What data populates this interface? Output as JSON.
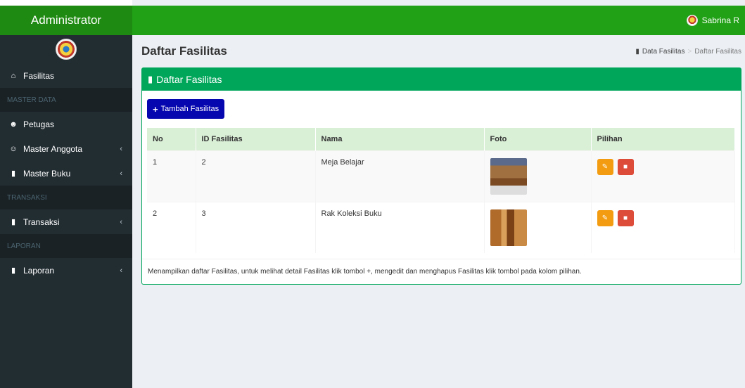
{
  "header": {
    "brand": "Administrator",
    "user_name": "Sabrina R"
  },
  "sidebar": {
    "items": [
      {
        "type": "item",
        "label": "Fasilitas",
        "icon": "home-icon"
      },
      {
        "type": "header",
        "label": "MASTER DATA"
      },
      {
        "type": "item",
        "label": "Petugas",
        "icon": "user-plus-icon"
      },
      {
        "type": "item",
        "label": "Master Anggota",
        "icon": "users-icon",
        "chevron": true
      },
      {
        "type": "item",
        "label": "Master Buku",
        "icon": "book-icon",
        "chevron": true
      },
      {
        "type": "header",
        "label": "TRANSAKSI"
      },
      {
        "type": "item",
        "label": "Transaksi",
        "icon": "book-icon",
        "chevron": true
      },
      {
        "type": "header",
        "label": "LAPORAN"
      },
      {
        "type": "item",
        "label": "Laporan",
        "icon": "book-icon",
        "chevron": true
      }
    ]
  },
  "page": {
    "title": "Daftar Fasilitas",
    "breadcrumb": {
      "parent": "Data Fasilitas",
      "current": "Daftar Fasilitas"
    }
  },
  "box": {
    "title": "Daftar Fasilitas",
    "add_label": "Tambah Fasilitas",
    "table": {
      "headers": [
        "No",
        "ID Fasilitas",
        "Nama",
        "Foto",
        "Pilihan"
      ],
      "rows": [
        {
          "no": "1",
          "id": "2",
          "nama": "Meja Belajar"
        },
        {
          "no": "2",
          "id": "3",
          "nama": "Rak Koleksi Buku"
        }
      ]
    },
    "footnote": "Menampilkan daftar Fasilitas, untuk melihat detail Fasilitas klik tombol +, mengedit dan menghapus Fasilitas klik tombol pada kolom pilihan."
  },
  "colors": {
    "topbar": "#21a116",
    "brand": "#1e8a11",
    "box": "#00a65a",
    "add_button": "#0707b0",
    "edit": "#f39c12",
    "delete": "#dd4b39"
  }
}
